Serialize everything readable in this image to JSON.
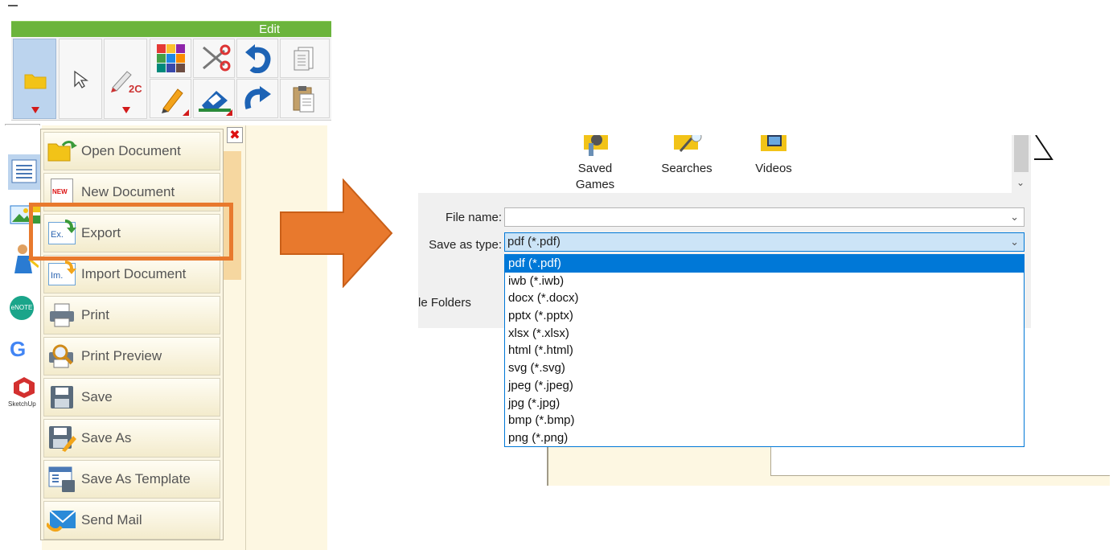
{
  "app": {
    "edit_label": "Edit",
    "toolbar_icons": [
      "folder-icon",
      "pointer-icon",
      "pen-2c-icon",
      "color-palette-icon",
      "scissors-icon",
      "undo-icon",
      "copy-icon",
      "pencil-icon",
      "eraser-icon",
      "redo-icon",
      "paste-icon"
    ],
    "pen_badge": "2C",
    "side_icons": [
      "page-list-icon",
      "gallery-icon",
      "person-icon",
      "enote-icon",
      "google-icon",
      "sketchup-icon"
    ],
    "enote_label": "eNOTE",
    "sketchup_label": "SketchUp",
    "menu": {
      "items": [
        {
          "label": "Open Document",
          "icon": "open-folder-icon"
        },
        {
          "label": "New Document",
          "icon": "new-document-icon",
          "badge": "NEW"
        },
        {
          "label": "Export",
          "icon": "export-icon",
          "badge": "Ex.",
          "highlighted": true
        },
        {
          "label": "Import Document",
          "icon": "import-icon",
          "badge": "Im."
        },
        {
          "label": "Print",
          "icon": "printer-icon"
        },
        {
          "label": "Print Preview",
          "icon": "print-preview-icon"
        },
        {
          "label": "Save",
          "icon": "save-icon"
        },
        {
          "label": "Save As",
          "icon": "save-as-icon"
        },
        {
          "label": "Save As Template",
          "icon": "template-icon"
        },
        {
          "label": "Send Mail",
          "icon": "mail-icon"
        }
      ]
    }
  },
  "dialog": {
    "folders": [
      {
        "label": "Saved Games",
        "icon": "saved-games-folder-icon"
      },
      {
        "label": "Searches",
        "icon": "searches-folder-icon"
      },
      {
        "label": "Videos",
        "icon": "videos-folder-icon"
      }
    ],
    "file_name_label": "File name:",
    "file_name_value": "",
    "save_as_type_label": "Save as type:",
    "save_as_type_value": "pdf (*.pdf)",
    "hide_folders_text": "le Folders",
    "options": [
      "pdf (*.pdf)",
      "iwb (*.iwb)",
      "docx (*.docx)",
      "pptx (*.pptx)",
      "xlsx (*.xlsx)",
      "html (*.html)",
      "svg (*.svg)",
      "jpeg (*.jpeg)",
      "jpg (*.jpg)",
      "bmp (*.bmp)",
      "png (*.png)"
    ],
    "selected_option": "pdf (*.pdf)"
  },
  "colors": {
    "accent_highlight": "#e8792d",
    "edit_bar": "#6bb43c",
    "selection_blue": "#0078d7"
  }
}
